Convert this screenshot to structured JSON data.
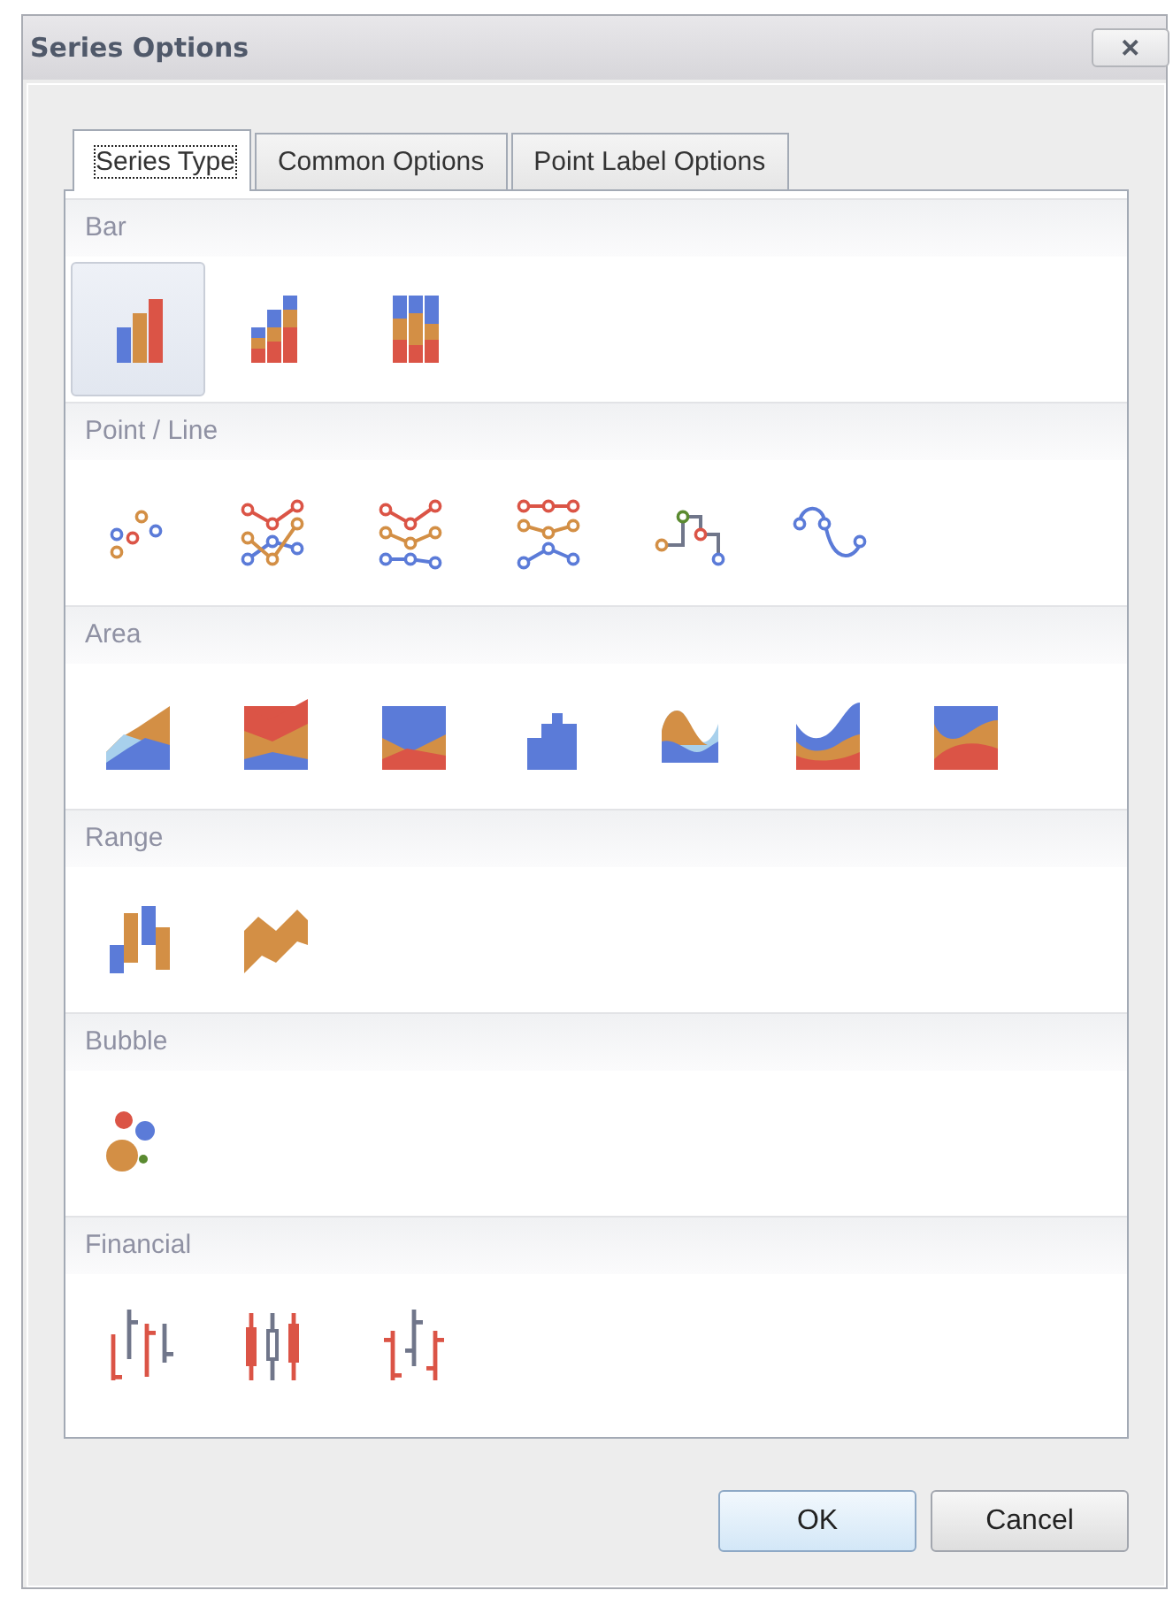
{
  "window": {
    "title": "Series Options",
    "close_button": "✕"
  },
  "tabs": [
    {
      "label": "Series Type",
      "selected": true
    },
    {
      "label": "Common Options",
      "selected": false
    },
    {
      "label": "Point Label Options",
      "selected": false
    }
  ],
  "groups": [
    {
      "label": "Bar",
      "items": [
        {
          "kind": "bar",
          "selected": true
        },
        {
          "kind": "stacked-bar",
          "selected": false
        },
        {
          "kind": "full-stacked-bar",
          "selected": false
        }
      ]
    },
    {
      "label": "Point / Line",
      "items": [
        {
          "kind": "point",
          "selected": false
        },
        {
          "kind": "line",
          "selected": false
        },
        {
          "kind": "stacked-line",
          "selected": false
        },
        {
          "kind": "full-stacked-line",
          "selected": false
        },
        {
          "kind": "step-line",
          "selected": false
        },
        {
          "kind": "spline",
          "selected": false
        }
      ]
    },
    {
      "label": "Area",
      "items": [
        {
          "kind": "area",
          "selected": false
        },
        {
          "kind": "stacked-area",
          "selected": false
        },
        {
          "kind": "full-stacked-area",
          "selected": false
        },
        {
          "kind": "step-area",
          "selected": false
        },
        {
          "kind": "spline-area",
          "selected": false
        },
        {
          "kind": "stacked-spline-area",
          "selected": false
        },
        {
          "kind": "full-stacked-spline-area",
          "selected": false
        }
      ]
    },
    {
      "label": "Range",
      "items": [
        {
          "kind": "range-bar",
          "selected": false
        },
        {
          "kind": "range-area",
          "selected": false
        }
      ]
    },
    {
      "label": "Bubble",
      "items": [
        {
          "kind": "bubble",
          "selected": false
        }
      ]
    },
    {
      "label": "Financial",
      "items": [
        {
          "kind": "stock",
          "selected": false
        },
        {
          "kind": "candlestick",
          "selected": false
        },
        {
          "kind": "open-close-stock",
          "selected": false
        }
      ]
    }
  ],
  "buttons": [
    {
      "label": "OK",
      "default": true
    },
    {
      "label": "Cancel",
      "default": false
    }
  ]
}
